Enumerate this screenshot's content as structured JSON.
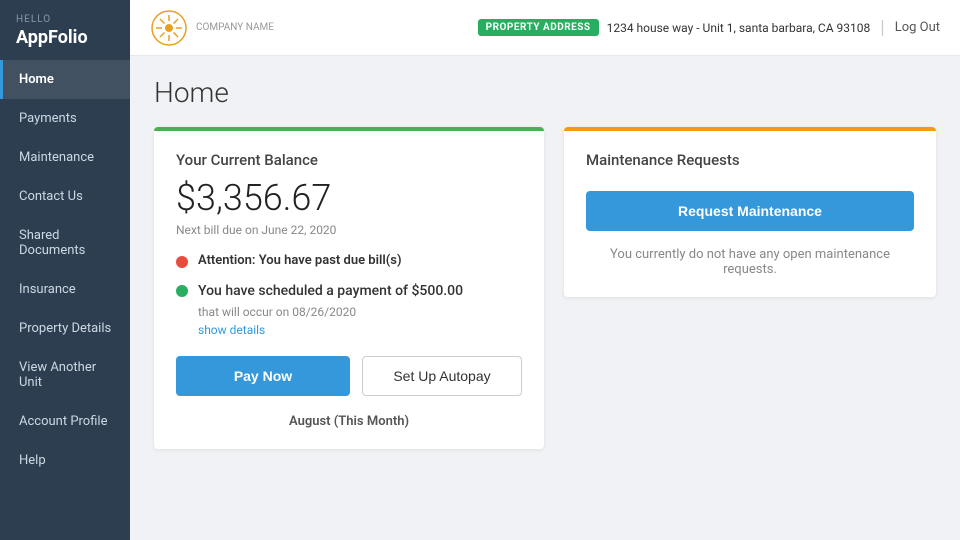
{
  "meta": {
    "hello_label": "HELLO",
    "app_name": "AppFolio"
  },
  "sidebar": {
    "items": [
      {
        "id": "home",
        "label": "Home",
        "active": true
      },
      {
        "id": "payments",
        "label": "Payments",
        "active": false
      },
      {
        "id": "maintenance",
        "label": "Maintenance",
        "active": false
      },
      {
        "id": "contact-us",
        "label": "Contact Us",
        "active": false
      },
      {
        "id": "shared-documents",
        "label": "Shared Documents",
        "active": false
      },
      {
        "id": "insurance",
        "label": "Insurance",
        "active": false
      },
      {
        "id": "property-details",
        "label": "Property Details",
        "active": false
      },
      {
        "id": "view-another-unit",
        "label": "View Another Unit",
        "active": false
      },
      {
        "id": "account-profile",
        "label": "Account Profile",
        "active": false
      },
      {
        "id": "help",
        "label": "Help",
        "active": false
      }
    ]
  },
  "header": {
    "company_name": "COMPANY NAME",
    "property_badge": "PROPERTY ADDRESS",
    "property_address": "1234 house way - Unit 1, santa barbara, CA 93108",
    "logout_label": "Log Out"
  },
  "page_title": "Home",
  "balance_card": {
    "title": "Your Current Balance",
    "amount": "$3,356.67",
    "next_bill": "Next bill due on June 22, 2020",
    "alert_text": "Attention: You have past due bill(s)",
    "scheduled_text": "You have scheduled a payment of $500.00",
    "scheduled_date": "that will occur on 08/26/2020",
    "show_details_label": "show details",
    "pay_now_label": "Pay Now",
    "autopay_label": "Set Up Autopay",
    "month_label": "August (This Month)"
  },
  "maintenance_card": {
    "title": "Maintenance Requests",
    "request_button_label": "Request Maintenance",
    "empty_text": "You currently do not have any open maintenance requests."
  }
}
